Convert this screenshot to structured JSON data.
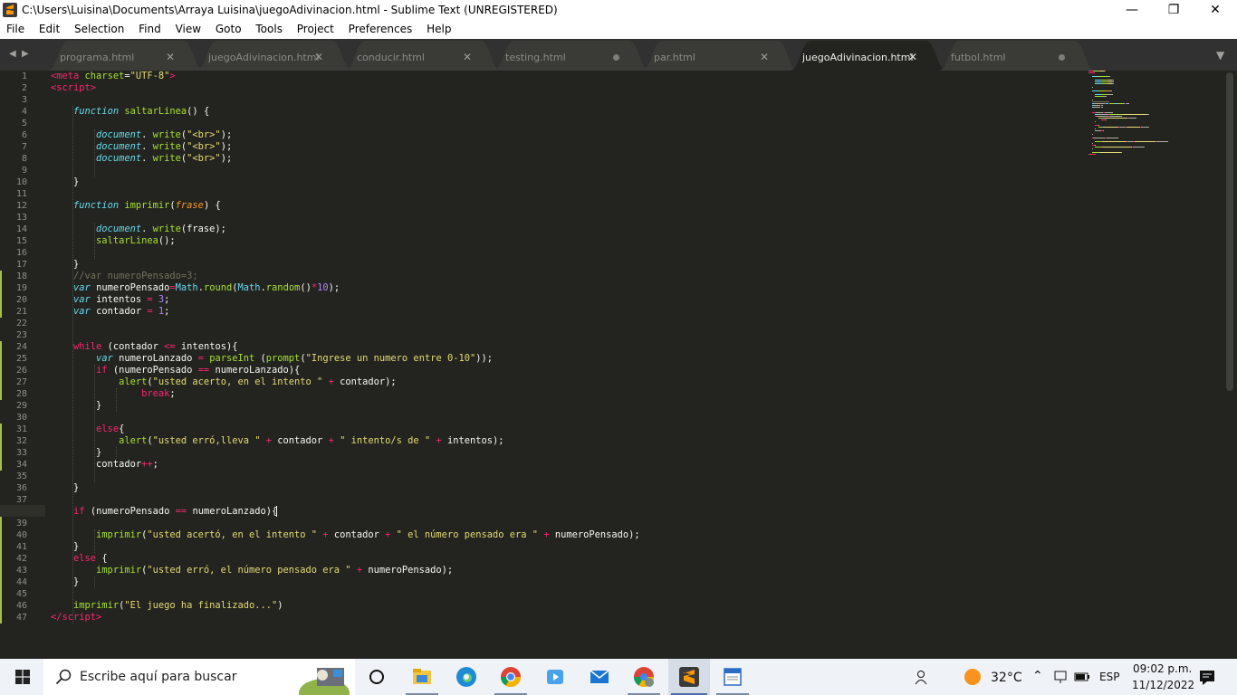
{
  "window": {
    "title": "C:\\Users\\Luisina\\Documents\\Arraya Luisina\\juegoAdivinacion.html - Sublime Text (UNREGISTERED)",
    "minimize": "—",
    "maximize": "❐",
    "close": "✕"
  },
  "menu": [
    "File",
    "Edit",
    "Selection",
    "Find",
    "View",
    "Goto",
    "Tools",
    "Project",
    "Preferences",
    "Help"
  ],
  "tabs": [
    {
      "label": "programa.html",
      "state": "close",
      "active": false
    },
    {
      "label": "juegoAdivinacion.html",
      "state": "close",
      "active": false
    },
    {
      "label": "conducir.html",
      "state": "close",
      "active": false
    },
    {
      "label": "testing.html",
      "state": "dirty",
      "active": false
    },
    {
      "label": "par.html",
      "state": "close",
      "active": false
    },
    {
      "label": "juegoAdivinacion.html",
      "state": "close",
      "active": true
    },
    {
      "label": "futbol.html",
      "state": "dirty",
      "active": false
    }
  ],
  "tab_close_glyph": "✕",
  "tab_nav": {
    "left": "◀",
    "right": "▶",
    "overflow": "▼"
  },
  "editor": {
    "current_line": 38,
    "modified_lines": [
      18,
      19,
      20,
      21,
      24,
      25,
      26,
      27,
      28,
      31,
      32,
      33,
      34,
      38,
      39,
      40,
      41,
      42,
      43,
      44,
      45,
      46,
      47
    ],
    "line_numbers": [
      "1",
      "2",
      "3",
      "4",
      "5",
      "6",
      "7",
      "8",
      "9",
      "10",
      "11",
      "12",
      "13",
      "14",
      "15",
      "16",
      "17",
      "18",
      "19",
      "20",
      "21",
      "22",
      "23",
      "24",
      "25",
      "26",
      "27",
      "28",
      "29",
      "30",
      "31",
      "32",
      "33",
      "34",
      "35",
      "36",
      "37",
      "38",
      "39",
      "40",
      "41",
      "42",
      "43",
      "44",
      "45",
      "46",
      "47"
    ],
    "lines": [
      [
        [
          "tag",
          "<meta "
        ],
        [
          "attr",
          "charset"
        ],
        [
          "",
          "="
        ],
        [
          "str",
          "\"UTF-8\""
        ],
        [
          "tag",
          ">"
        ]
      ],
      [
        [
          "tag",
          "<script"
        ],
        [
          "tag",
          ">"
        ]
      ],
      [],
      [
        [
          "",
          "    "
        ],
        [
          "kw",
          "function "
        ],
        [
          "fn",
          "saltarLinea"
        ],
        [
          "",
          "() {"
        ]
      ],
      [],
      [
        [
          "",
          "        "
        ],
        [
          "bi",
          "document"
        ],
        [
          "",
          ". "
        ],
        [
          "fn",
          "write"
        ],
        [
          "",
          "("
        ],
        [
          "str",
          "\"<br>\""
        ],
        [
          "",
          ");"
        ]
      ],
      [
        [
          "",
          "        "
        ],
        [
          "bi",
          "document"
        ],
        [
          "",
          ". "
        ],
        [
          "fn",
          "write"
        ],
        [
          "",
          "("
        ],
        [
          "str",
          "\"<br>\""
        ],
        [
          "",
          ");"
        ]
      ],
      [
        [
          "",
          "        "
        ],
        [
          "bi",
          "document"
        ],
        [
          "",
          ". "
        ],
        [
          "fn",
          "write"
        ],
        [
          "",
          "("
        ],
        [
          "str",
          "\"<br>\""
        ],
        [
          "",
          ");"
        ]
      ],
      [],
      [
        [
          "",
          "    }"
        ]
      ],
      [],
      [
        [
          "",
          "    "
        ],
        [
          "kw",
          "function "
        ],
        [
          "fn",
          "imprimir"
        ],
        [
          "",
          "("
        ],
        [
          "prm",
          "frase"
        ],
        [
          "",
          ") {"
        ]
      ],
      [],
      [
        [
          "",
          "        "
        ],
        [
          "bi",
          "document"
        ],
        [
          "",
          ". "
        ],
        [
          "fn",
          "write"
        ],
        [
          "",
          "(frase);"
        ]
      ],
      [
        [
          "",
          "        "
        ],
        [
          "fn",
          "saltarLinea"
        ],
        [
          "",
          "();"
        ]
      ],
      [],
      [
        [
          "",
          "    }"
        ]
      ],
      [
        [
          "",
          "    "
        ],
        [
          "cmt",
          "//var numeroPensado=3;"
        ]
      ],
      [
        [
          "",
          "    "
        ],
        [
          "kw",
          "var "
        ],
        [
          "",
          "numeroPensado"
        ],
        [
          "op",
          "="
        ],
        [
          "cls2",
          "Math"
        ],
        [
          "",
          "."
        ],
        [
          "fn",
          "round"
        ],
        [
          "",
          "("
        ],
        [
          "cls2",
          "Math"
        ],
        [
          "",
          "."
        ],
        [
          "fn",
          "random"
        ],
        [
          "",
          "()"
        ],
        [
          "op",
          "*"
        ],
        [
          "num",
          "10"
        ],
        [
          "",
          ");"
        ]
      ],
      [
        [
          "",
          "    "
        ],
        [
          "kw",
          "var "
        ],
        [
          "",
          "intentos "
        ],
        [
          "op",
          "= "
        ],
        [
          "num",
          "3"
        ],
        [
          "",
          ";"
        ]
      ],
      [
        [
          "",
          "    "
        ],
        [
          "kw",
          "var "
        ],
        [
          "",
          "contador "
        ],
        [
          "op",
          "= "
        ],
        [
          "num",
          "1"
        ],
        [
          "",
          ";"
        ]
      ],
      [],
      [],
      [
        [
          "",
          "    "
        ],
        [
          "ctl",
          "while "
        ],
        [
          "",
          "(contador "
        ],
        [
          "op",
          "<= "
        ],
        [
          "",
          "intentos){"
        ]
      ],
      [
        [
          "",
          "        "
        ],
        [
          "kw",
          "var "
        ],
        [
          "",
          "numeroLanzado "
        ],
        [
          "op",
          "= "
        ],
        [
          "fn",
          "parseInt "
        ],
        [
          "",
          "("
        ],
        [
          "fn",
          "prompt"
        ],
        [
          "",
          "("
        ],
        [
          "str",
          "\"Ingrese un numero entre 0-10\""
        ],
        [
          "",
          "));"
        ]
      ],
      [
        [
          "",
          "        "
        ],
        [
          "ctl",
          "if "
        ],
        [
          "",
          "(numeroPensado "
        ],
        [
          "op",
          "== "
        ],
        [
          "",
          "numeroLanzado){"
        ]
      ],
      [
        [
          "",
          "            "
        ],
        [
          "fn",
          "alert"
        ],
        [
          "",
          "("
        ],
        [
          "str",
          "\"usted acerto, en el intento \" "
        ],
        [
          "op",
          "+ "
        ],
        [
          "",
          "contador);"
        ]
      ],
      [
        [
          "",
          "                "
        ],
        [
          "ctl",
          "break"
        ],
        [
          "",
          ";"
        ]
      ],
      [
        [
          "",
          "        }"
        ]
      ],
      [],
      [
        [
          "",
          "        "
        ],
        [
          "ctl",
          "else"
        ],
        [
          "",
          "{"
        ]
      ],
      [
        [
          "",
          "            "
        ],
        [
          "fn",
          "alert"
        ],
        [
          "",
          "("
        ],
        [
          "str",
          "\"usted erró,lleva \" "
        ],
        [
          "op",
          "+ "
        ],
        [
          "",
          "contador "
        ],
        [
          "op",
          "+ "
        ],
        [
          "str",
          "\" intento/s de \" "
        ],
        [
          "op",
          "+ "
        ],
        [
          "",
          "intentos);"
        ]
      ],
      [
        [
          "",
          "        }"
        ]
      ],
      [
        [
          "",
          "        contador"
        ],
        [
          "op",
          "++"
        ],
        [
          "",
          ";"
        ]
      ],
      [],
      [
        [
          "",
          "    }"
        ]
      ],
      [],
      [
        [
          "",
          "    "
        ],
        [
          "ctl",
          "if "
        ],
        [
          "",
          "(numeroPensado "
        ],
        [
          "op",
          "== "
        ],
        [
          "",
          "numeroLanzado){"
        ]
      ],
      [],
      [
        [
          "",
          "        "
        ],
        [
          "fn",
          "imprimir"
        ],
        [
          "",
          "("
        ],
        [
          "str",
          "\"usted acertó, en el intento \" "
        ],
        [
          "op",
          "+ "
        ],
        [
          "",
          "contador "
        ],
        [
          "op",
          "+ "
        ],
        [
          "str",
          "\" el número pensado era \" "
        ],
        [
          "op",
          "+ "
        ],
        [
          "",
          "numeroPensado);"
        ]
      ],
      [
        [
          "",
          "    }"
        ]
      ],
      [
        [
          "",
          "    "
        ],
        [
          "ctl",
          "else "
        ],
        [
          "",
          "{"
        ]
      ],
      [
        [
          "",
          "        "
        ],
        [
          "fn",
          "imprimir"
        ],
        [
          "",
          "("
        ],
        [
          "str",
          "\"usted erró, el número pensado era \" "
        ],
        [
          "op",
          "+ "
        ],
        [
          "",
          "numeroPensado);"
        ]
      ],
      [
        [
          "",
          "    }"
        ]
      ],
      [],
      [
        [
          "",
          "    "
        ],
        [
          "fn",
          "imprimir"
        ],
        [
          "",
          "("
        ],
        [
          "str",
          "\"El juego ha finalizado...\""
        ],
        [
          "",
          ")"
        ]
      ],
      [
        [
          "tag",
          "</script"
        ],
        [
          "tag",
          ">"
        ]
      ]
    ]
  },
  "colors": {
    "background": "#23241f",
    "tag": "#f92672",
    "string": "#e6db74",
    "keyword": "#66d9ef",
    "function": "#a6e22e",
    "number": "#ae81ff",
    "comment": "#75715e",
    "modified_marker": "#a6c04a"
  },
  "taskbar": {
    "search_placeholder": "Escribe aquí para buscar",
    "weather_temp": "32°C",
    "language": "ESP",
    "time": "09:02 p.m.",
    "date": "11/12/2022",
    "apps": [
      "task-view",
      "file-explorer",
      "edge",
      "chrome",
      "media-player",
      "mail",
      "chrome-profile",
      "sublime-text",
      "wordpad"
    ]
  }
}
